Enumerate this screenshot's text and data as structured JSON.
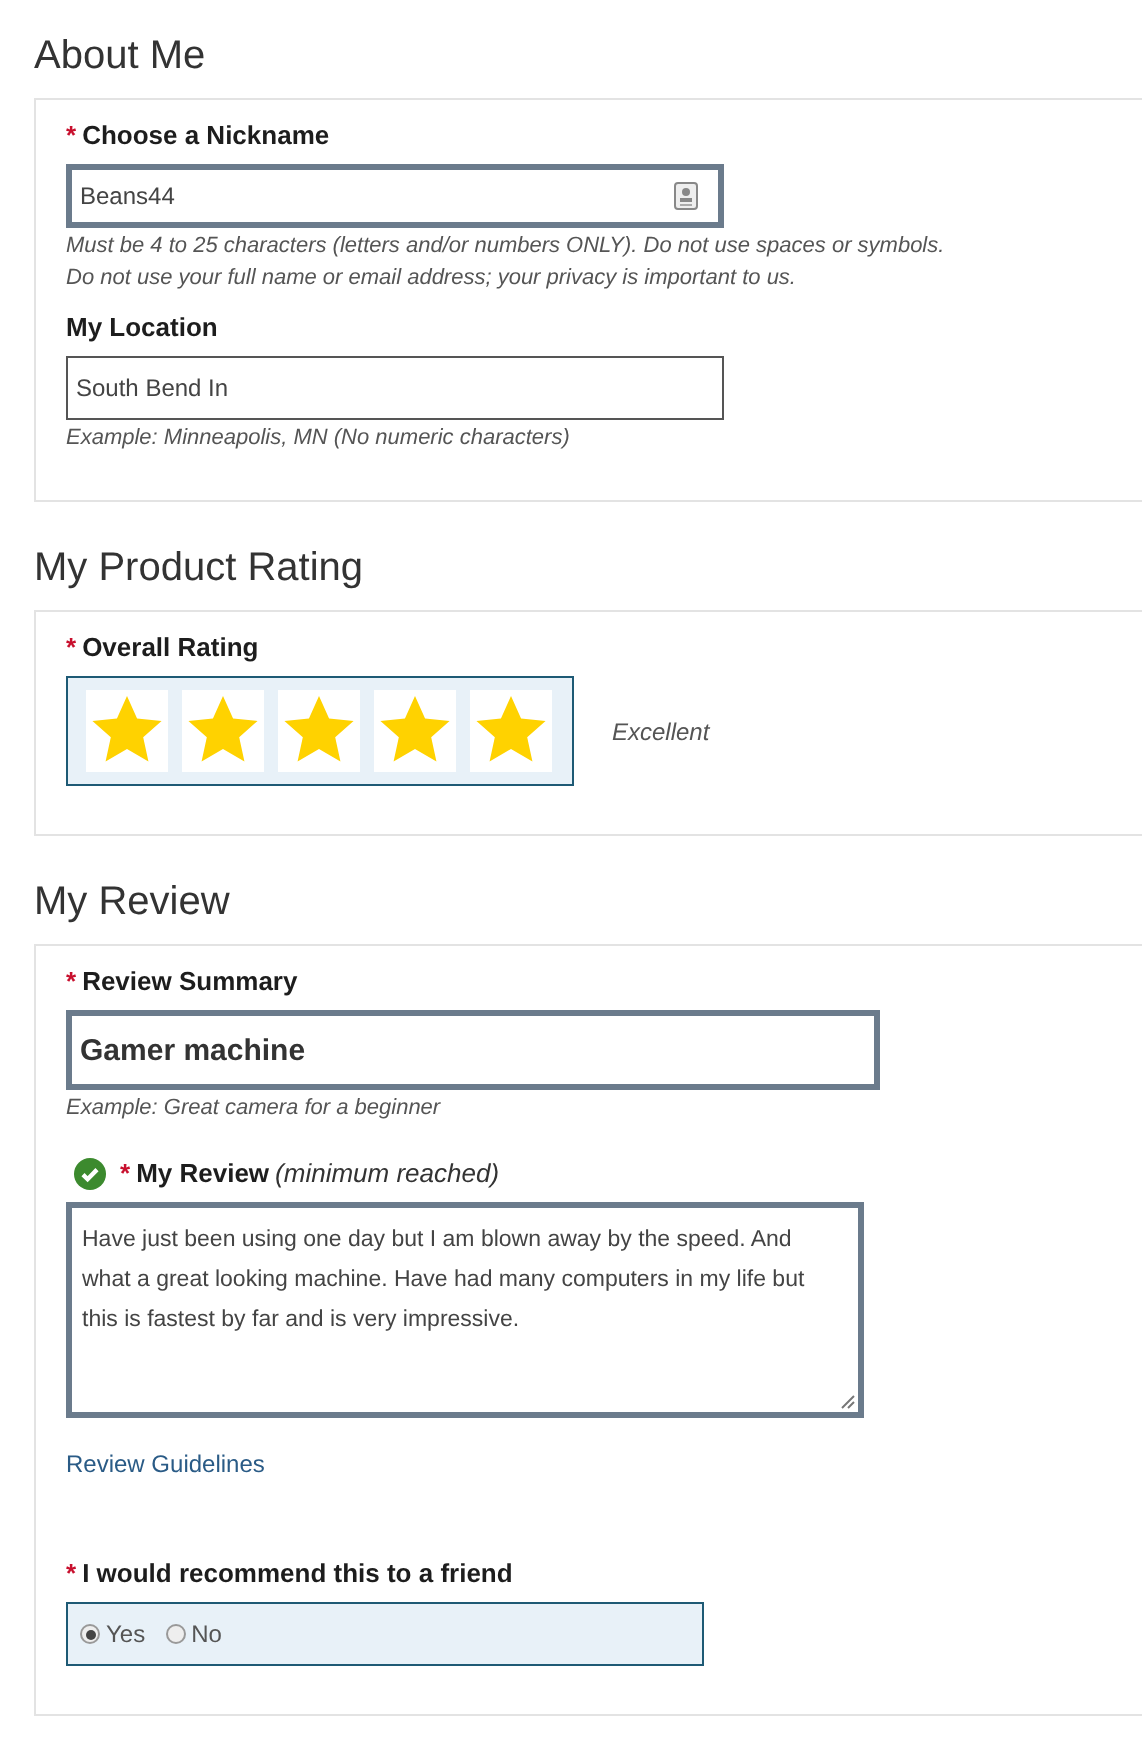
{
  "sections": [
    {
      "title": "About Me",
      "fields": [
        {
          "kind": "text",
          "required_mark": "*",
          "label": "Choose a Nickname",
          "value": "Beans44",
          "highlighted": true,
          "has_icon": true,
          "hint": [
            "Must be 4 to 25 characters (letters and/or numbers ONLY). Do not use spaces or symbols.",
            "Do not use your full name or email address; your privacy is important to us."
          ]
        },
        {
          "kind": "text",
          "label": "My Location",
          "value": "South Bend In",
          "highlighted": false,
          "has_icon": false,
          "hint": [
            "Example: Minneapolis, MN (No numeric characters)"
          ]
        }
      ]
    },
    {
      "title": "My Product Rating",
      "fields": [
        {
          "kind": "rating",
          "required_mark": "*",
          "label": "Overall Rating",
          "stars": 5,
          "reading": "Excellent"
        }
      ]
    },
    {
      "title": "My Review",
      "fields": [
        {
          "kind": "summary",
          "required_mark": "*",
          "label": "Review Summary",
          "value": "Gamer machine",
          "highlighted": true,
          "hint": [
            "Example: Great camera for a beginner"
          ]
        },
        {
          "kind": "textarea",
          "required_mark": "*",
          "label": "My Review",
          "note": "(minimum reached)",
          "valid": true,
          "value": "Have just been using one day but I am blown away by the speed. And what a great looking machine. Have had many computers in my life but this is fastest by far and is very impressive."
        },
        {
          "kind": "link",
          "label": "Review Guidelines"
        },
        {
          "kind": "radio",
          "required_mark": "*",
          "label": "I would recommend this to a friend",
          "options": [
            {
              "label": "Yes",
              "selected": true
            },
            {
              "label": "No",
              "selected": false
            }
          ]
        }
      ]
    }
  ]
}
